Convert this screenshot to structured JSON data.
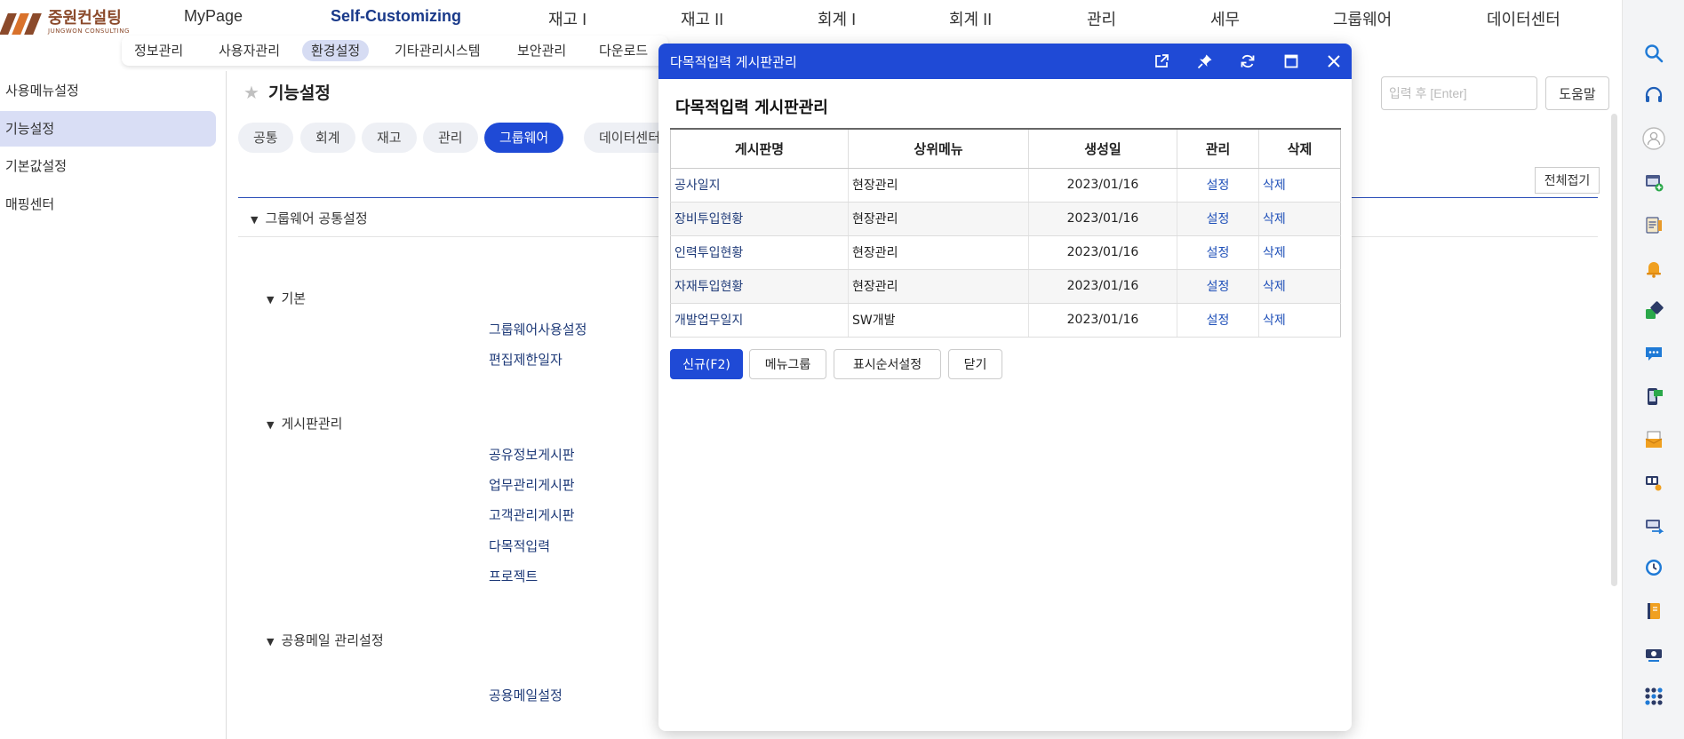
{
  "logo": {
    "korean": "중원컨설팅",
    "english": "JUNGWON CONSULTING"
  },
  "top_nav": [
    {
      "label": "MyPage",
      "active": false
    },
    {
      "label": "Self-Customizing",
      "active": true
    },
    {
      "label": "재고 I",
      "active": false
    },
    {
      "label": "재고 II",
      "active": false
    },
    {
      "label": "회계 I",
      "active": false
    },
    {
      "label": "회계 II",
      "active": false
    },
    {
      "label": "관리",
      "active": false
    },
    {
      "label": "세무",
      "active": false
    },
    {
      "label": "그룹웨어",
      "active": false
    },
    {
      "label": "데이터센터",
      "active": false
    }
  ],
  "sub_nav": [
    {
      "label": "정보관리",
      "active": false
    },
    {
      "label": "사용자관리",
      "active": false
    },
    {
      "label": "환경설정",
      "active": true
    },
    {
      "label": "기타관리시스템",
      "active": false
    },
    {
      "label": "보안관리",
      "active": false
    },
    {
      "label": "다운로드",
      "active": false
    }
  ],
  "sidebar": [
    {
      "label": "사용메뉴설정",
      "active": false
    },
    {
      "label": "기능설정",
      "active": true
    },
    {
      "label": "기본값설정",
      "active": false
    },
    {
      "label": "매핑센터",
      "active": false
    }
  ],
  "main": {
    "title": "기능설정",
    "tabs": [
      {
        "label": "공통",
        "active": false
      },
      {
        "label": "회계",
        "active": false
      },
      {
        "label": "재고",
        "active": false
      },
      {
        "label": "관리",
        "active": false
      },
      {
        "label": "그룹웨어",
        "active": true
      },
      {
        "label": "데이터센터",
        "active": false
      }
    ],
    "search_placeholder": "입력 후 [Enter]",
    "help_label": "도움말",
    "collapse_label": "전체접기",
    "section_title": "그룹웨어 공통설정",
    "groups": [
      {
        "title": "기본",
        "links": [
          "그룹웨어사용설정",
          "편집제한일자"
        ]
      },
      {
        "title": "게시판관리",
        "links": [
          "공유정보게시판",
          "업무관리게시판",
          "고객관리게시판",
          "다목적입력",
          "프로젝트"
        ]
      },
      {
        "title": "공용메일 관리설정",
        "links": [
          "공용메일설정"
        ]
      }
    ]
  },
  "modal": {
    "title_bar": "다목적입력 게시판관리",
    "heading": "다목적입력 게시판관리",
    "columns": [
      "게시판명",
      "상위메뉴",
      "생성일",
      "관리",
      "삭제"
    ],
    "rows": [
      {
        "name": "공사일지",
        "parent": "현장관리",
        "date": "2023/01/16",
        "manage": "설정",
        "delete": "삭제"
      },
      {
        "name": "장비투입현황",
        "parent": "현장관리",
        "date": "2023/01/16",
        "manage": "설정",
        "delete": "삭제"
      },
      {
        "name": "인력투입현황",
        "parent": "현장관리",
        "date": "2023/01/16",
        "manage": "설정",
        "delete": "삭제"
      },
      {
        "name": "자재투입현황",
        "parent": "현장관리",
        "date": "2023/01/16",
        "manage": "설정",
        "delete": "삭제"
      },
      {
        "name": "개발업무일지",
        "parent": "SW개발",
        "date": "2023/01/16",
        "manage": "설정",
        "delete": "삭제"
      }
    ],
    "buttons": {
      "new": "신규(F2)",
      "menu_group": "메뉴그룹",
      "display_order": "표시순서설정",
      "close": "닫기"
    }
  },
  "right_rail_icons": [
    "search-icon",
    "headset-icon",
    "user-icon",
    "add-window-icon",
    "notepad-icon",
    "bell-icon",
    "exchange-icon",
    "chat-icon",
    "mobile-message-icon",
    "mail-tray-icon",
    "clock-user-icon",
    "transfer-icon",
    "history-icon",
    "book-icon",
    "money-icon",
    "apps-grid-icon"
  ],
  "colors": {
    "primary": "#1f4ad6",
    "brand": "#8b4a2b",
    "link": "#1e3a78"
  }
}
